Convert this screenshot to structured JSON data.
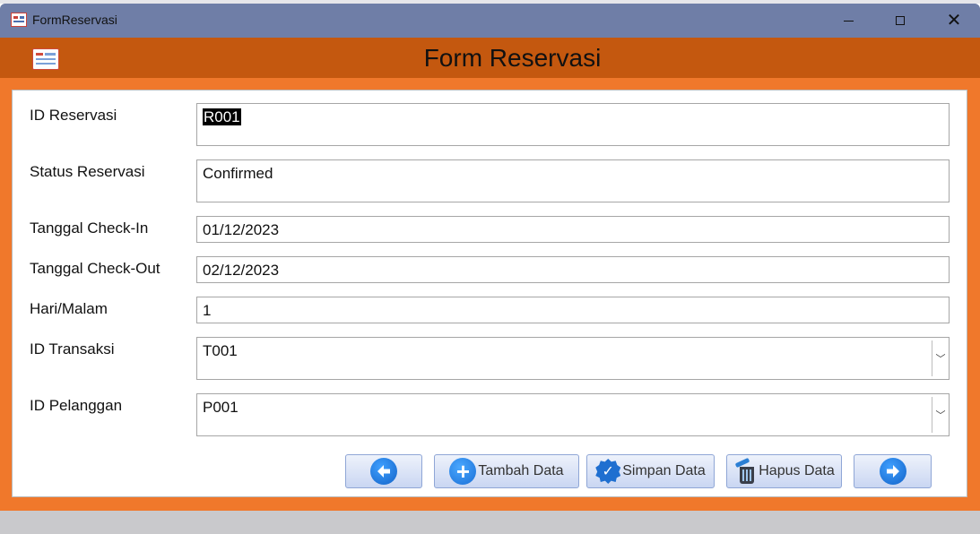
{
  "window": {
    "title": "FormReservasi"
  },
  "header": {
    "title": "Form Reservasi"
  },
  "fields": [
    {
      "label": "ID Reservasi",
      "value": "R001"
    },
    {
      "label": "Status Reservasi",
      "value": "Confirmed"
    },
    {
      "label": "Tanggal Check-In",
      "value": "01/12/2023"
    },
    {
      "label": "Tanggal Check-Out",
      "value": "02/12/2023"
    },
    {
      "label": "Hari/Malam",
      "value": "1"
    },
    {
      "label": "ID Transaksi",
      "value": "T001"
    },
    {
      "label": "ID Pelanggan",
      "value": "P001"
    }
  ],
  "buttons": {
    "tambah": "Tambah Data",
    "simpan": "Simpan Data",
    "hapus": "Hapus Data"
  },
  "icons": {
    "prev": "arrow-left-icon",
    "next": "arrow-right-icon",
    "add": "plus-icon",
    "save": "check-icon",
    "delete": "trash-icon"
  },
  "colors": {
    "titlebar": "#6f7ea7",
    "header": "#c4580f",
    "frame": "#f0782b"
  }
}
